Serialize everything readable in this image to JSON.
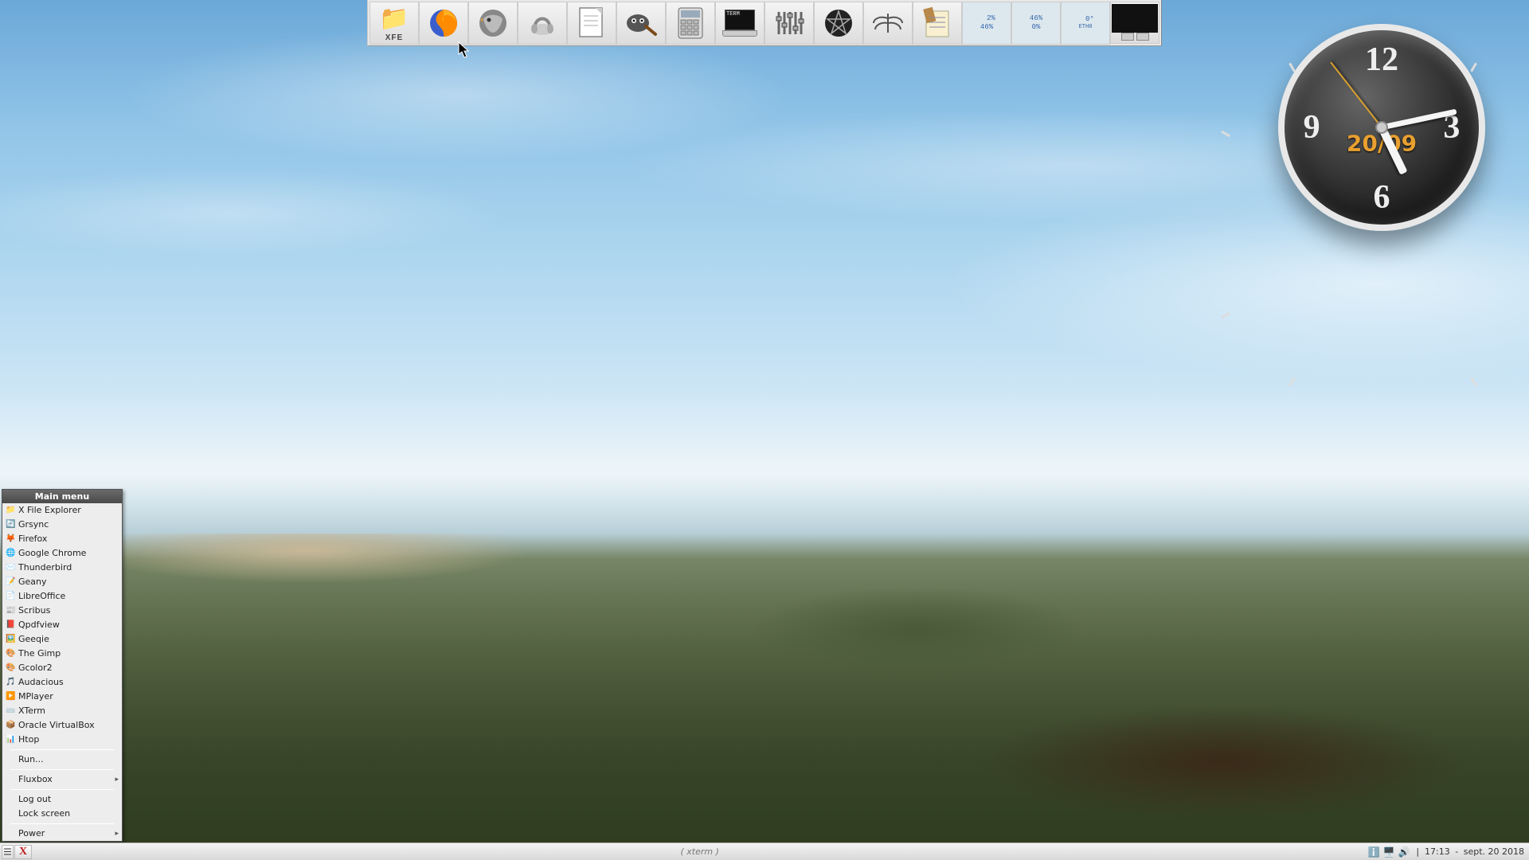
{
  "dock": {
    "items": [
      {
        "name": "xfe-launcher",
        "label": "XFE",
        "icon": "folder"
      },
      {
        "name": "firefox-launcher",
        "label": "",
        "icon": "firefox"
      },
      {
        "name": "thunderbird-launcher",
        "label": "",
        "icon": "thunderbird"
      },
      {
        "name": "audacious-launcher",
        "label": "",
        "icon": "audio"
      },
      {
        "name": "libreoffice-launcher",
        "label": "",
        "icon": "document"
      },
      {
        "name": "gimp-launcher",
        "label": "",
        "icon": "gimp"
      },
      {
        "name": "calculator-launcher",
        "label": "",
        "icon": "calc"
      },
      {
        "name": "terminal-launcher",
        "label": "TERM",
        "icon": "term"
      },
      {
        "name": "equalizer-launcher",
        "label": "",
        "icon": "equalizer"
      },
      {
        "name": "occult-launcher",
        "label": "",
        "icon": "pentagram"
      },
      {
        "name": "wings-launcher",
        "label": "",
        "icon": "wings"
      },
      {
        "name": "notes-launcher",
        "label": "",
        "icon": "notes"
      }
    ],
    "monitors": [
      {
        "name": "cpu-monitor",
        "line1": "  2%",
        "line2": "46%"
      },
      {
        "name": "mem-monitor",
        "line1": "46%",
        "line2": "0%"
      },
      {
        "name": "net-monitor",
        "line1": "  0°",
        "line2": "ETH0"
      }
    ]
  },
  "menu": {
    "title": "Main menu",
    "groups": [
      [
        {
          "icon": "📁",
          "label": "X File Explorer"
        },
        {
          "icon": "🔄",
          "label": "Grsync"
        },
        {
          "icon": "🦊",
          "label": "Firefox"
        },
        {
          "icon": "🌐",
          "label": "Google Chrome"
        },
        {
          "icon": "✉️",
          "label": "Thunderbird"
        },
        {
          "icon": "📝",
          "label": "Geany"
        },
        {
          "icon": "📄",
          "label": "LibreOffice"
        },
        {
          "icon": "📰",
          "label": "Scribus"
        },
        {
          "icon": "📕",
          "label": "Qpdfview"
        },
        {
          "icon": "🖼️",
          "label": "Geeqie"
        },
        {
          "icon": "🎨",
          "label": "The Gimp"
        },
        {
          "icon": "🎨",
          "label": "Gcolor2"
        },
        {
          "icon": "🎵",
          "label": "Audacious"
        },
        {
          "icon": "▶️",
          "label": "MPlayer"
        },
        {
          "icon": "⌨️",
          "label": "XTerm"
        },
        {
          "icon": "📦",
          "label": "Oracle VirtualBox"
        },
        {
          "icon": "📊",
          "label": "Htop"
        }
      ],
      [
        {
          "icon": "",
          "label": "Run..."
        }
      ],
      [
        {
          "icon": "",
          "label": "Fluxbox",
          "submenu": true
        }
      ],
      [
        {
          "icon": "",
          "label": "Log out"
        },
        {
          "icon": "",
          "label": "Lock screen"
        }
      ],
      [
        {
          "icon": "",
          "label": "Power",
          "submenu": true
        }
      ]
    ]
  },
  "clock": {
    "date": "20/09",
    "numerals": {
      "n12": "12",
      "n3": "3",
      "n6": "6",
      "n9": "9"
    }
  },
  "taskbar": {
    "active_window": "( xterm )",
    "time": "17:13",
    "date": "sept. 20 2018",
    "separator": "|"
  }
}
